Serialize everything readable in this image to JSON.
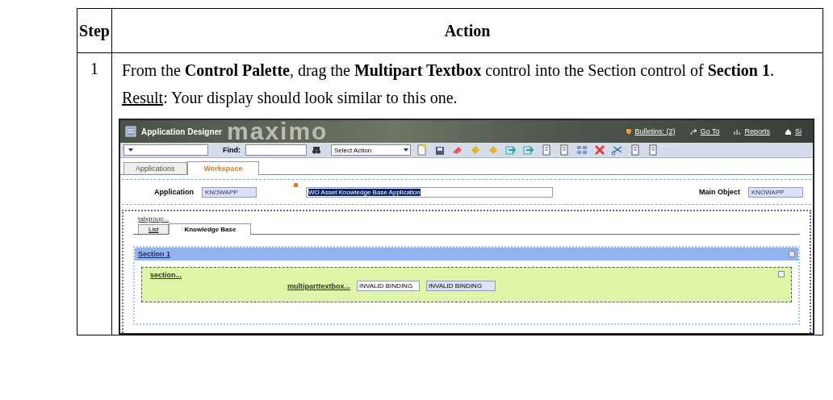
{
  "table": {
    "columns": [
      "Step",
      "Action"
    ],
    "rows": [
      {
        "step": "1",
        "instruction": "From the **Control Palette**, drag the **Multipart Textbox** control into the Section control of **Section 1**.",
        "result_label": "Result",
        "result_text": ": Your display should look similar to this one.",
        "screenshot": {
          "window_title": "Application Designer",
          "logo": "maximo",
          "header_links": [
            "Bulletins: (2)",
            "Go To",
            "Reports",
            "Si"
          ],
          "find_label": "Find:",
          "action_select": "Select Action",
          "tabs": [
            {
              "label": "Applications",
              "selected": false
            },
            {
              "label": "Workspace",
              "selected": true
            }
          ],
          "application": {
            "label": "Application",
            "value": "KNOWAPP",
            "required": true,
            "description": "WO Asset Knowledge Base Application"
          },
          "main_object": {
            "label": "Main Object",
            "value": "KNOWAPP"
          },
          "tabgroup": "tabgroup...",
          "inner_tabs": [
            {
              "label": "List",
              "selected": false
            },
            {
              "label": "Knowledge Base",
              "selected": true
            }
          ],
          "section_title": "Section 1",
          "subsection": "section...",
          "control_label": "multiparttextbox...",
          "bindings": [
            "INVALID BINDING",
            "INVALID BINDING"
          ]
        }
      }
    ]
  }
}
